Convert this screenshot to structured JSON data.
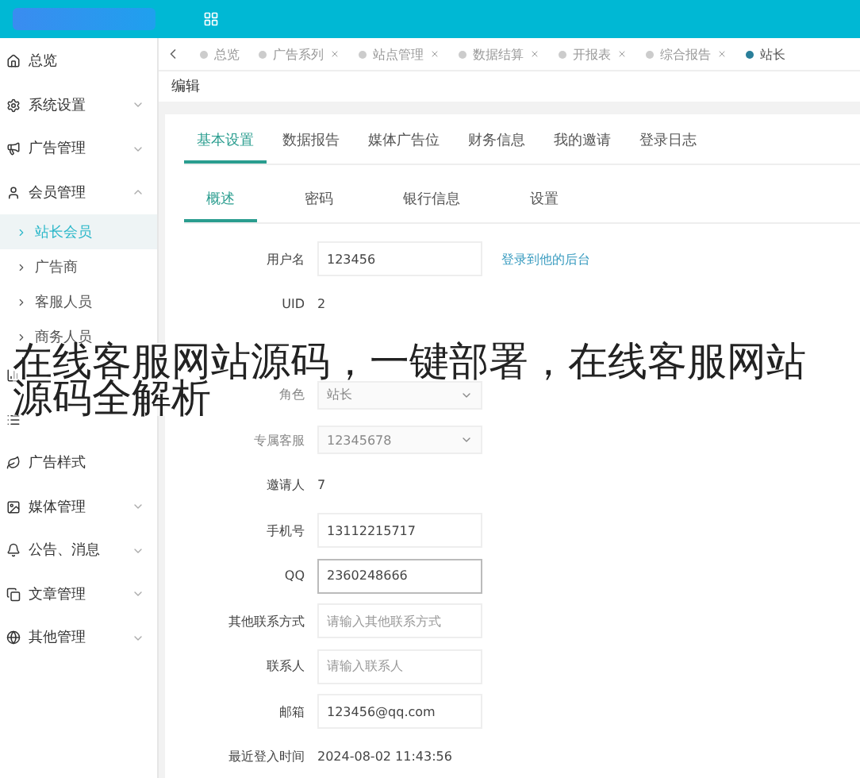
{
  "sidebar": {
    "items": [
      {
        "kind": "item",
        "label": "总览"
      },
      {
        "kind": "item",
        "label": "系统设置",
        "expanded": false
      },
      {
        "kind": "item",
        "label": "广告管理",
        "expanded": false
      },
      {
        "kind": "item",
        "label": "会员管理",
        "expanded": true,
        "children": [
          {
            "label": "站长会员",
            "selected": true
          },
          {
            "label": "广告商",
            "selected": false
          },
          {
            "label": "客服人员",
            "selected": false
          },
          {
            "label": "商务人员",
            "selected": false
          }
        ]
      },
      {
        "kind": "covered"
      },
      {
        "kind": "covered"
      },
      {
        "kind": "item",
        "label": "广告样式"
      },
      {
        "kind": "item",
        "label": "媒体管理",
        "expanded": false
      },
      {
        "kind": "item",
        "label": "公告、消息",
        "expanded": false
      },
      {
        "kind": "item",
        "label": "文章管理",
        "expanded": false
      },
      {
        "kind": "item",
        "label": "其他管理",
        "expanded": false
      }
    ]
  },
  "page_tabs": [
    {
      "label": "总览",
      "selected": false,
      "closable": false
    },
    {
      "label": "广告系列",
      "selected": false,
      "closable": true
    },
    {
      "label": "站点管理",
      "selected": false,
      "closable": true
    },
    {
      "label": "数据结算",
      "selected": false,
      "closable": true
    },
    {
      "label": "开报表",
      "selected": false,
      "closable": true
    },
    {
      "label": "综合报告",
      "selected": false,
      "closable": true
    },
    {
      "label": "站长",
      "selected": true,
      "closable": false
    }
  ],
  "page_title": "编辑",
  "tabs": [
    {
      "label": "基本设置",
      "selected": true
    },
    {
      "label": "数据报告",
      "selected": false
    },
    {
      "label": "媒体广告位",
      "selected": false
    },
    {
      "label": "财务信息",
      "selected": false
    },
    {
      "label": "我的邀请",
      "selected": false
    },
    {
      "label": "登录日志",
      "selected": false
    }
  ],
  "sub_tabs": [
    {
      "label": "概述",
      "selected": true
    },
    {
      "label": "密码",
      "selected": false
    },
    {
      "label": "银行信息",
      "selected": false
    },
    {
      "label": "设置",
      "selected": false
    }
  ],
  "form": [
    {
      "kind": "input",
      "label": "用户名",
      "value": "123456",
      "link": "登录到他的后台"
    },
    {
      "kind": "text",
      "label": "UID",
      "value": "2"
    },
    {
      "kind": "hidden"
    },
    {
      "kind": "select",
      "label": "角色",
      "value": "站长",
      "disabled": true
    },
    {
      "kind": "select",
      "label": "专属客服",
      "value": "12345678",
      "disabled": true
    },
    {
      "kind": "text",
      "label": "邀请人",
      "value": "7"
    },
    {
      "kind": "input",
      "label": "手机号",
      "value": "13112215717"
    },
    {
      "kind": "input",
      "label": "QQ",
      "value": "2360248666",
      "focused": true
    },
    {
      "kind": "input",
      "label": "其他联系方式",
      "placeholder": "请输入其他联系方式"
    },
    {
      "kind": "input",
      "label": "联系人",
      "placeholder": "请输入联系人"
    },
    {
      "kind": "input",
      "label": "邮箱",
      "value": "123456@qq.com"
    },
    {
      "kind": "text",
      "label": "最近登入时间",
      "value": "2024-08-02 11:43:56"
    }
  ],
  "overlay_caption": [
    "在线客服网站源码，一键部署，在线客服网站",
    "源码全解析"
  ]
}
